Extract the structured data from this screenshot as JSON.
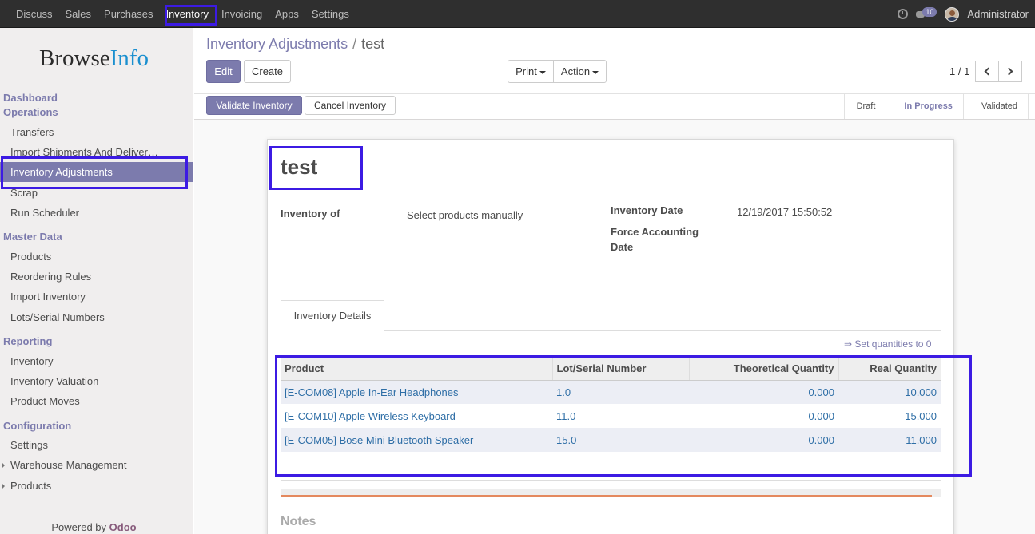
{
  "topbar": {
    "menu": [
      "Discuss",
      "Sales",
      "Purchases",
      "Inventory",
      "Invoicing",
      "Apps",
      "Settings"
    ],
    "active_menu": "Inventory",
    "chat_count": "10",
    "user": "Administrator"
  },
  "sidebar": {
    "logo": {
      "part1": "Browse",
      "part2": "Info"
    },
    "sections": {
      "dashboard": "Dashboard",
      "operations": "Operations",
      "master_data": "Master Data",
      "reporting": "Reporting",
      "configuration": "Configuration"
    },
    "operations_items": [
      "Transfers",
      "Import Shipments And Deliver…",
      "Inventory Adjustments",
      "Scrap",
      "Run Scheduler"
    ],
    "master_items": [
      "Products",
      "Reordering Rules",
      "Import Inventory",
      "Lots/Serial Numbers"
    ],
    "reporting_items": [
      "Inventory",
      "Inventory Valuation",
      "Product Moves"
    ],
    "config_items": [
      "Settings",
      "Warehouse Management",
      "Products"
    ],
    "powered_by": "Powered by",
    "powered_brand": "Odoo"
  },
  "breadcrumb": {
    "parent": "Inventory Adjustments",
    "separator": "/",
    "current": "test"
  },
  "buttons": {
    "edit": "Edit",
    "create": "Create",
    "print": "Print",
    "action": "Action",
    "validate": "Validate Inventory",
    "cancel": "Cancel Inventory"
  },
  "pager": "1 / 1",
  "status": {
    "stages": [
      "Draft",
      "In Progress",
      "Validated"
    ],
    "active": "In Progress"
  },
  "record": {
    "name": "test",
    "inventory_of_label": "Inventory of",
    "inventory_of_value": "Select products manually",
    "inventory_date_label": "Inventory Date",
    "inventory_date_value": "12/19/2017 15:50:52",
    "force_date_label_1": "Force Accounting",
    "force_date_label_2": "Date"
  },
  "tab": "Inventory Details",
  "set_quantities": "⇒ Set quantities to 0",
  "table": {
    "headers": [
      "Product",
      "Lot/Serial Number",
      "Theoretical Quantity",
      "Real Quantity"
    ],
    "rows": [
      [
        "[E-COM08] Apple In-Ear Headphones",
        "1.0",
        "0.000",
        "10.000"
      ],
      [
        "[E-COM10] Apple Wireless Keyboard",
        "11.0",
        "0.000",
        "15.000"
      ],
      [
        "[E-COM05] Bose Mini Bluetooth Speaker",
        "15.0",
        "0.000",
        "11.000"
      ]
    ]
  },
  "notes_label": "Notes"
}
